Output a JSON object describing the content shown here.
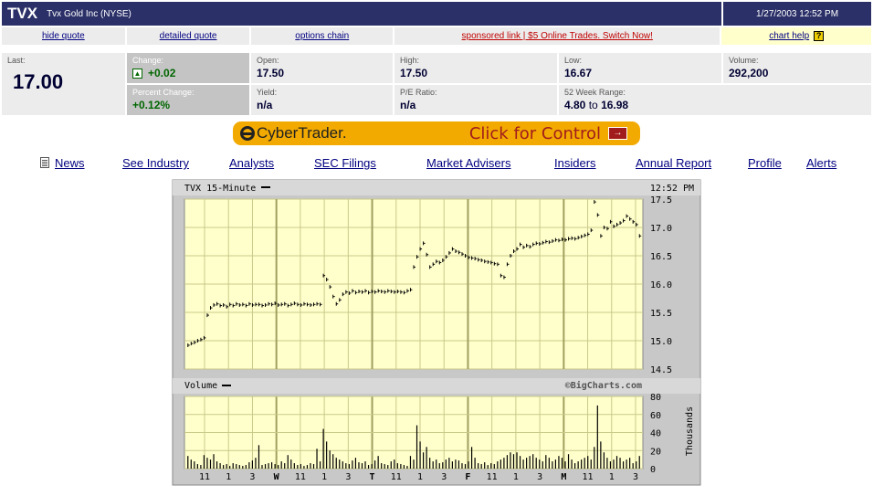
{
  "header": {
    "symbol": "TVX",
    "company": "Tvx Gold Inc (NYSE)",
    "datetime": "1/27/2003 12:52 PM"
  },
  "nav": {
    "hide_quote": "hide quote",
    "detailed_quote": "detailed quote",
    "options_chain": "options chain",
    "sponsored": "sponsored link | $5 Online Trades. Switch Now!",
    "chart_help": "chart help",
    "help_icon": "?"
  },
  "quote": {
    "last_label": "Last:",
    "last_value": "17.00",
    "change_label": "Change:",
    "change_value": "+0.02",
    "pct_label": "Percent Change:",
    "pct_value": "+0.12%",
    "open_label": "Open:",
    "open_value": "17.50",
    "yield_label": "Yield:",
    "yield_value": "n/a",
    "high_label": "High:",
    "high_value": "17.50",
    "pe_label": "P/E Ratio:",
    "pe_value": "n/a",
    "low_label": "Low:",
    "low_value": "16.67",
    "range_label": "52 Week Range:",
    "range_low": "4.80",
    "range_to": "to",
    "range_high": "16.98",
    "volume_label": "Volume:",
    "volume_value": "292,200",
    "up_icon": "arrow-up-icon"
  },
  "banner": {
    "brand": "CyberTrader.",
    "cta": "Click for Control",
    "bg_color": "#f2a900",
    "cta_color": "#a11d1d"
  },
  "links": [
    "News",
    "See Industry",
    "Analysts",
    "SEC Filings",
    "Market Advisers",
    "Insiders",
    "Annual Report",
    "Profile",
    "Alerts"
  ],
  "chart_data": {
    "type": "bar",
    "price_panel": {
      "title": "TVX 15-Minute",
      "time": "12:52 PM",
      "ylim": [
        14.5,
        17.5
      ],
      "yticks": [
        "17.5",
        "17.0",
        "16.5",
        "16.0",
        "15.5",
        "15.0",
        "14.5"
      ],
      "values": [
        14.92,
        14.95,
        14.97,
        15.0,
        15.02,
        15.05,
        15.45,
        15.58,
        15.63,
        15.65,
        15.62,
        15.63,
        15.6,
        15.64,
        15.62,
        15.65,
        15.63,
        15.64,
        15.62,
        15.65,
        15.63,
        15.64,
        15.64,
        15.62,
        15.63,
        15.65,
        15.64,
        15.66,
        15.63,
        15.64,
        15.65,
        15.62,
        15.64,
        15.66,
        15.64,
        15.63,
        15.65,
        15.64,
        15.63,
        15.64,
        15.65,
        15.64,
        16.15,
        16.08,
        15.95,
        15.78,
        15.65,
        15.72,
        15.82,
        15.86,
        15.84,
        15.88,
        15.85,
        15.87,
        15.86,
        15.88,
        15.85,
        15.87,
        15.86,
        15.88,
        15.87,
        15.86,
        15.88,
        15.87,
        15.86,
        15.87,
        15.86,
        15.85,
        15.88,
        15.9,
        16.3,
        16.48,
        16.62,
        16.72,
        16.52,
        16.3,
        16.35,
        16.4,
        16.38,
        16.42,
        16.48,
        16.55,
        16.62,
        16.58,
        16.56,
        16.53,
        16.5,
        16.47,
        16.46,
        16.45,
        16.43,
        16.42,
        16.4,
        16.39,
        16.38,
        16.36,
        16.35,
        16.15,
        16.12,
        16.35,
        16.5,
        16.58,
        16.62,
        16.7,
        16.65,
        16.68,
        16.66,
        16.7,
        16.72,
        16.71,
        16.73,
        16.75,
        16.74,
        16.76,
        16.78,
        16.77,
        16.79,
        16.78,
        16.8,
        16.81,
        16.8,
        16.82,
        16.84,
        16.86,
        16.88,
        16.95,
        17.45,
        17.22,
        16.85,
        17.0,
        16.98,
        17.1,
        17.02,
        17.05,
        17.08,
        17.12,
        17.2,
        17.15,
        17.1,
        17.05,
        16.85
      ],
      "volume_label": "Volume",
      "watermark": "©BigCharts.com"
    },
    "volume_panel": {
      "ylabel": "Thousands",
      "ylim": [
        0,
        80
      ],
      "yticks": [
        "80",
        "60",
        "40",
        "20",
        "0"
      ],
      "values": [
        14,
        10,
        8,
        5,
        4,
        15,
        12,
        10,
        16,
        8,
        6,
        4,
        5,
        3,
        6,
        5,
        4,
        3,
        4,
        7,
        9,
        12,
        26,
        4,
        5,
        6,
        7,
        5,
        4,
        8,
        6,
        15,
        10,
        6,
        4,
        5,
        3,
        4,
        6,
        5,
        22,
        8,
        44,
        30,
        20,
        16,
        12,
        10,
        8,
        6,
        5,
        9,
        12,
        7,
        6,
        8,
        4,
        5,
        9,
        14,
        6,
        5,
        4,
        8,
        10,
        6,
        5,
        4,
        3,
        14,
        10,
        48,
        30,
        18,
        24,
        12,
        8,
        10,
        6,
        7,
        10,
        12,
        8,
        10,
        9,
        6,
        5,
        8,
        24,
        12,
        6,
        5,
        7,
        4,
        6,
        5,
        8,
        10,
        12,
        15,
        18,
        16,
        18,
        14,
        10,
        12,
        14,
        16,
        12,
        10,
        8,
        15,
        12,
        8,
        10,
        14,
        12,
        8,
        16,
        10,
        6,
        8,
        10,
        12,
        14,
        10,
        24,
        70,
        30,
        18,
        12,
        8,
        10,
        14,
        12,
        8,
        10,
        12,
        6,
        8,
        14
      ],
      "xticks": [
        "11",
        "1",
        "3",
        "W",
        "11",
        "1",
        "3",
        "T",
        "11",
        "1",
        "3",
        "F",
        "11",
        "1",
        "3",
        "M",
        "11",
        "1",
        "3"
      ]
    }
  }
}
